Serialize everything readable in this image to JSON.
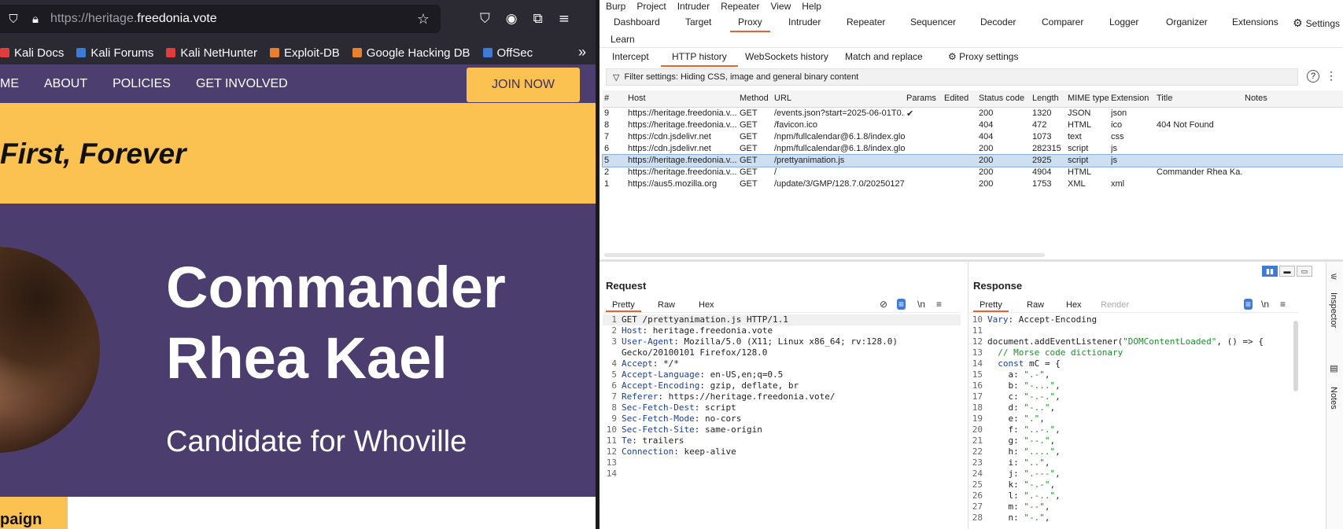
{
  "browser": {
    "url_prefix": "https://heritage.",
    "url_domain": "freedonia.vote",
    "bookmarks": [
      {
        "label": "Kali Docs",
        "color": "#e23d3d"
      },
      {
        "label": "Kali Forums",
        "color": "#3d7bd9"
      },
      {
        "label": "Kali NetHunter",
        "color": "#e23d3d"
      },
      {
        "label": "Exploit-DB",
        "color": "#e8812c"
      },
      {
        "label": "Google Hacking DB",
        "color": "#e8812c"
      },
      {
        "label": "OffSec",
        "color": "#3d7bd9"
      }
    ]
  },
  "site": {
    "nav": [
      "ME",
      "ABOUT",
      "POLICIES",
      "GET INVOLVED"
    ],
    "join_label": "JOIN NOW",
    "tagline": "First, Forever",
    "hero_name_line1": "Commander",
    "hero_name_line2": "Rhea Kael",
    "hero_subtitle": "Candidate for Whoville",
    "campaign_label": "paign"
  },
  "burp": {
    "menu": [
      "Burp",
      "Project",
      "Intruder",
      "Repeater",
      "View",
      "Help"
    ],
    "main_tabs": [
      "Dashboard",
      "Target",
      "Proxy",
      "Intruder",
      "Repeater",
      "Sequencer",
      "Decoder",
      "Comparer",
      "Logger",
      "Organizer",
      "Extensions",
      "Learn"
    ],
    "settings_label": "Settings",
    "proxy_tabs": [
      "Intercept",
      "HTTP history",
      "WebSockets history",
      "Match and replace"
    ],
    "proxy_settings_label": "Proxy settings",
    "filter_text": "Filter settings: Hiding CSS, image and general binary content",
    "columns": [
      "#",
      "Host",
      "Method",
      "URL",
      "Params",
      "Edited",
      "Status code",
      "Length",
      "MIME type",
      "Extension",
      "Title",
      "Notes"
    ],
    "rows": [
      {
        "num": "9",
        "host": "https://heritage.freedonia.v...",
        "method": "GET",
        "url": "/events.json?start=2025-06-01T0...",
        "params": "✔",
        "status": "200",
        "length": "1320",
        "mime": "JSON",
        "ext": "json",
        "title": ""
      },
      {
        "num": "8",
        "host": "https://heritage.freedonia.v...",
        "method": "GET",
        "url": "/favicon.ico",
        "params": "",
        "status": "404",
        "length": "472",
        "mime": "HTML",
        "ext": "ico",
        "title": "404 Not Found"
      },
      {
        "num": "7",
        "host": "https://cdn.jsdelivr.net",
        "method": "GET",
        "url": "/npm/fullcalendar@6.1.8/index.glo...",
        "params": "",
        "status": "404",
        "length": "1073",
        "mime": "text",
        "ext": "css",
        "title": ""
      },
      {
        "num": "6",
        "host": "https://cdn.jsdelivr.net",
        "method": "GET",
        "url": "/npm/fullcalendar@6.1.8/index.glo...",
        "params": "",
        "status": "200",
        "length": "282315",
        "mime": "script",
        "ext": "js",
        "title": ""
      },
      {
        "num": "5",
        "host": "https://heritage.freedonia.v...",
        "method": "GET",
        "url": "/prettyanimation.js",
        "params": "",
        "status": "200",
        "length": "2925",
        "mime": "script",
        "ext": "js",
        "title": ""
      },
      {
        "num": "2",
        "host": "https://heritage.freedonia.v...",
        "method": "GET",
        "url": "/",
        "params": "",
        "status": "200",
        "length": "4904",
        "mime": "HTML",
        "ext": "",
        "title": "Commander Rhea Ka..."
      },
      {
        "num": "1",
        "host": "https://aus5.mozilla.org",
        "method": "GET",
        "url": "/update/3/GMP/128.7.0/20250127...",
        "params": "",
        "status": "200",
        "length": "1753",
        "mime": "XML",
        "ext": "xml",
        "title": ""
      }
    ],
    "request_title": "Request",
    "response_title": "Response",
    "pane_tabs": [
      "Pretty",
      "Raw",
      "Hex",
      "Render"
    ],
    "newline_label": "\\n",
    "request_lines": [
      {
        "n": "1",
        "k": "",
        "v": "GET /prettyanimation.js HTTP/1.1"
      },
      {
        "n": "2",
        "k": "Host",
        "v": ": heritage.freedonia.vote"
      },
      {
        "n": "3",
        "k": "User-Agent",
        "v": ": Mozilla/5.0 (X11; Linux x86_64; rv:128.0)"
      },
      {
        "n": "",
        "k": "",
        "v": "Gecko/20100101 Firefox/128.0"
      },
      {
        "n": "4",
        "k": "Accept",
        "v": ": */*"
      },
      {
        "n": "5",
        "k": "Accept-Language",
        "v": ": en-US,en;q=0.5"
      },
      {
        "n": "6",
        "k": "Accept-Encoding",
        "v": ": gzip, deflate, br"
      },
      {
        "n": "7",
        "k": "Referer",
        "v": ": https://heritage.freedonia.vote/"
      },
      {
        "n": "8",
        "k": "Sec-Fetch-Dest",
        "v": ": script"
      },
      {
        "n": "9",
        "k": "Sec-Fetch-Mode",
        "v": ": no-cors"
      },
      {
        "n": "10",
        "k": "Sec-Fetch-Site",
        "v": ": same-origin"
      },
      {
        "n": "11",
        "k": "Te",
        "v": ": trailers"
      },
      {
        "n": "12",
        "k": "Connection",
        "v": ": keep-alive"
      },
      {
        "n": "13",
        "k": "",
        "v": ""
      },
      {
        "n": "14",
        "k": "",
        "v": ""
      }
    ],
    "response_lines": [
      {
        "n": "10",
        "a": "Vary",
        "b": ": Accept-Encoding",
        "c": "",
        "d": ""
      },
      {
        "n": "11",
        "a": "",
        "b": "",
        "c": "",
        "d": ""
      },
      {
        "n": "12",
        "a": "",
        "b": "document.addEventListener(",
        "c": "\"DOMContentLoaded\"",
        "d": ", () => {"
      },
      {
        "n": "13",
        "a": "",
        "b": "  ",
        "c": "// Morse code dictionary",
        "d": ""
      },
      {
        "n": "14",
        "a": "  const",
        "b": " mC = {",
        "c": "",
        "d": ""
      },
      {
        "n": "15",
        "a": "",
        "b": "    a: ",
        "c": "\".-\"",
        "d": ","
      },
      {
        "n": "16",
        "a": "",
        "b": "    b: ",
        "c": "\"-...\"",
        "d": ","
      },
      {
        "n": "17",
        "a": "",
        "b": "    c: ",
        "c": "\"-.-.\"",
        "d": ","
      },
      {
        "n": "18",
        "a": "",
        "b": "    d: ",
        "c": "\"-..\"",
        "d": ","
      },
      {
        "n": "19",
        "a": "",
        "b": "    e: ",
        "c": "\".\"",
        "d": ","
      },
      {
        "n": "20",
        "a": "",
        "b": "    f: ",
        "c": "\"..-.\"",
        "d": ","
      },
      {
        "n": "21",
        "a": "",
        "b": "    g: ",
        "c": "\"--.\"",
        "d": ","
      },
      {
        "n": "22",
        "a": "",
        "b": "    h: ",
        "c": "\"....\"",
        "d": ","
      },
      {
        "n": "23",
        "a": "",
        "b": "    i: ",
        "c": "\"..\"",
        "d": ","
      },
      {
        "n": "24",
        "a": "",
        "b": "    j: ",
        "c": "\".---\"",
        "d": ","
      },
      {
        "n": "25",
        "a": "",
        "b": "    k: ",
        "c": "\"-.-\"",
        "d": ","
      },
      {
        "n": "26",
        "a": "",
        "b": "    l: ",
        "c": "\".-..\"",
        "d": ","
      },
      {
        "n": "27",
        "a": "",
        "b": "    m: ",
        "c": "\"--\"",
        "d": ","
      },
      {
        "n": "28",
        "a": "",
        "b": "    n: ",
        "c": "\"-.\"",
        "d": ","
      }
    ],
    "side_labels": [
      "Inspector",
      "Notes"
    ],
    "colors": {
      "accent": "#e8622c",
      "selected_row": "#cfdff2",
      "toggle_on": "#3f7ad6"
    }
  }
}
